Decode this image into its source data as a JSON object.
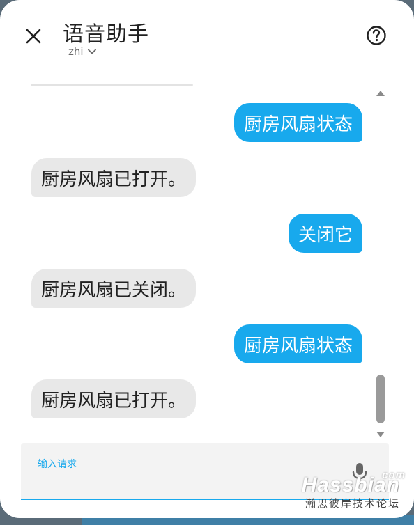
{
  "dialog": {
    "title": "语音助手",
    "language": "zhi"
  },
  "icons": {
    "close": "close-icon",
    "help": "help-circle-icon",
    "language_dropdown": "chevron-down-icon",
    "microphone": "microphone-icon"
  },
  "conversation": [
    {
      "who": "user",
      "text": "厨房风扇状态"
    },
    {
      "who": "hass",
      "text": "厨房风扇已打开。"
    },
    {
      "who": "user",
      "text": "关闭它"
    },
    {
      "who": "hass",
      "text": "厨房风扇已关闭。"
    },
    {
      "who": "user",
      "text": "厨房风扇状态"
    },
    {
      "who": "hass",
      "text": "厨房风扇已打开。"
    }
  ],
  "input": {
    "label": "输入请求",
    "value": ""
  },
  "watermark": {
    "brand": "Hassbian",
    "suffix": "com",
    "subtitle": "瀚思彼岸技术论坛"
  },
  "colors": {
    "accent": "#18a9ed",
    "user_bubble": "#18a9ed",
    "assistant_bubble": "#e8e8e8",
    "text": "#212121"
  }
}
